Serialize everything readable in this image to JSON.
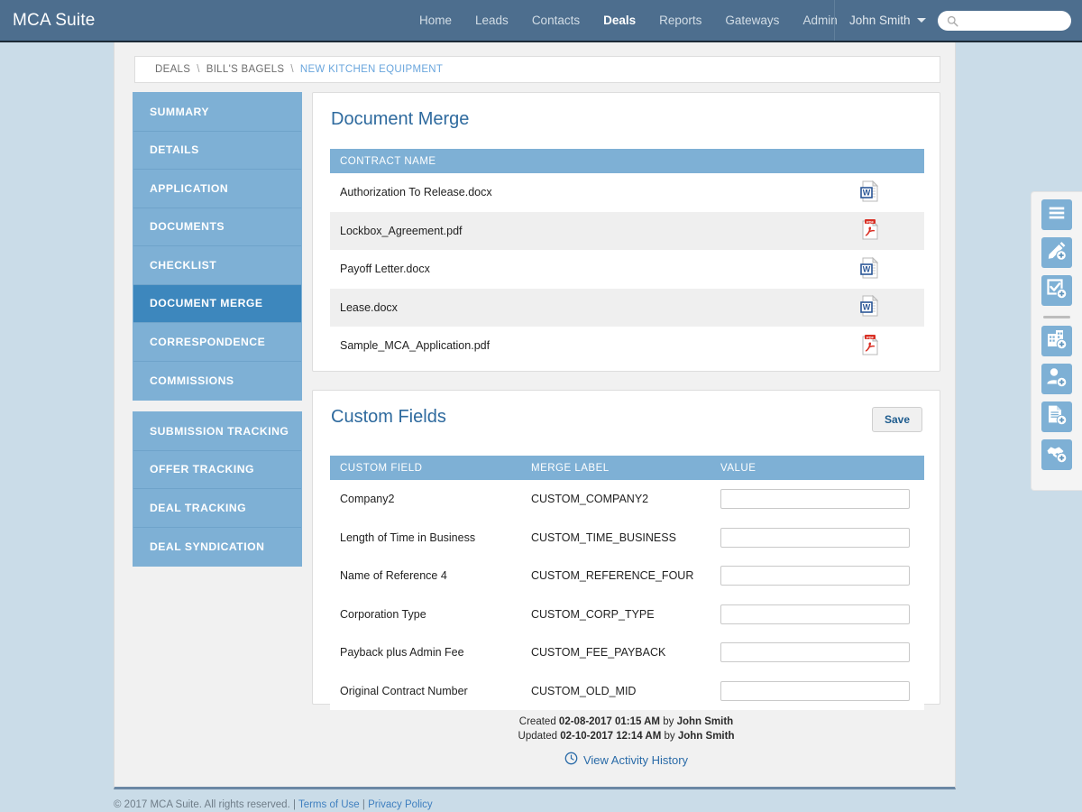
{
  "header": {
    "brand": "MCA Suite",
    "nav": [
      {
        "label": "Home",
        "active": false
      },
      {
        "label": "Leads",
        "active": false
      },
      {
        "label": "Contacts",
        "active": false
      },
      {
        "label": "Deals",
        "active": true
      },
      {
        "label": "Reports",
        "active": false
      },
      {
        "label": "Gateways",
        "active": false
      },
      {
        "label": "Admin",
        "active": false
      }
    ],
    "user": "John Smith",
    "search_value": "",
    "search_placeholder": ""
  },
  "breadcrumb": {
    "items": [
      "DEALS",
      "BILL'S BAGELS",
      "NEW KITCHEN EQUIPMENT"
    ],
    "separator": "\\"
  },
  "sidebar": {
    "groups": [
      {
        "items": [
          {
            "label": "SUMMARY",
            "active": false
          },
          {
            "label": "DETAILS",
            "active": false
          },
          {
            "label": "APPLICATION",
            "active": false
          },
          {
            "label": "DOCUMENTS",
            "active": false
          },
          {
            "label": "CHECKLIST",
            "active": false
          },
          {
            "label": "DOCUMENT MERGE",
            "active": true
          },
          {
            "label": "CORRESPONDENCE",
            "active": false
          },
          {
            "label": "COMMISSIONS",
            "active": false
          }
        ]
      },
      {
        "items": [
          {
            "label": "SUBMISSION TRACKING",
            "active": false
          },
          {
            "label": "OFFER TRACKING",
            "active": false
          },
          {
            "label": "DEAL TRACKING",
            "active": false
          },
          {
            "label": "DEAL SYNDICATION",
            "active": false
          }
        ]
      }
    ]
  },
  "document_merge": {
    "title": "Document Merge",
    "columns": [
      "CONTRACT NAME",
      ""
    ],
    "rows": [
      {
        "name": "Authorization To Release.docx",
        "icon": "word-doc-icon"
      },
      {
        "name": "Lockbox_Agreement.pdf",
        "icon": "pdf-doc-icon"
      },
      {
        "name": "Payoff Letter.docx",
        "icon": "word-doc-icon"
      },
      {
        "name": "Lease.docx",
        "icon": "word-doc-icon"
      },
      {
        "name": "Sample_MCA_Application.pdf",
        "icon": "pdf-doc-icon"
      }
    ]
  },
  "custom_fields": {
    "title": "Custom Fields",
    "save_label": "Save",
    "columns": [
      "CUSTOM FIELD",
      "MERGE LABEL",
      "VALUE"
    ],
    "rows": [
      {
        "field": "Company2",
        "merge_label": "CUSTOM_COMPANY2",
        "value": ""
      },
      {
        "field": "Length of Time in Business",
        "merge_label": "CUSTOM_TIME_BUSINESS",
        "value": ""
      },
      {
        "field": "Name of Reference 4",
        "merge_label": "CUSTOM_REFERENCE_FOUR",
        "value": ""
      },
      {
        "field": "Corporation Type",
        "merge_label": "CUSTOM_CORP_TYPE",
        "value": ""
      },
      {
        "field": "Payback plus Admin Fee",
        "merge_label": "CUSTOM_FEE_PAYBACK",
        "value": ""
      },
      {
        "field": "Original Contract Number",
        "merge_label": "CUSTOM_OLD_MID",
        "value": ""
      }
    ]
  },
  "record_meta": {
    "created_prefix": "Created",
    "created_stamp": "02-08-2017 01:15 AM",
    "created_by_word": "by",
    "created_by": "John Smith",
    "updated_prefix": "Updated",
    "updated_stamp": "02-10-2017 12:14 AM",
    "updated_by_word": "by",
    "updated_by": "John Smith",
    "activity_link": "View Activity History"
  },
  "quickbar": {
    "buttons": [
      {
        "icon": "menu-list-icon"
      },
      {
        "icon": "add-note-icon"
      },
      {
        "icon": "add-task-icon"
      },
      {
        "icon": "divider"
      },
      {
        "icon": "add-company-icon"
      },
      {
        "icon": "add-contact-icon"
      },
      {
        "icon": "add-document-icon"
      },
      {
        "icon": "add-deal-icon"
      }
    ]
  },
  "footer": {
    "copyright": "© 2017 MCA Suite. All rights reserved. |",
    "terms_label": "Terms of Use",
    "pipe": "|",
    "privacy_label": "Privacy Policy"
  },
  "colors": {
    "header_bg": "#4d6e8e",
    "page_bg": "#cadce8",
    "accent_blue": "#7eb0d5",
    "active_nav": "#3d87bd",
    "panel_title": "#2e6a9e",
    "link": "#3f7fbf"
  }
}
